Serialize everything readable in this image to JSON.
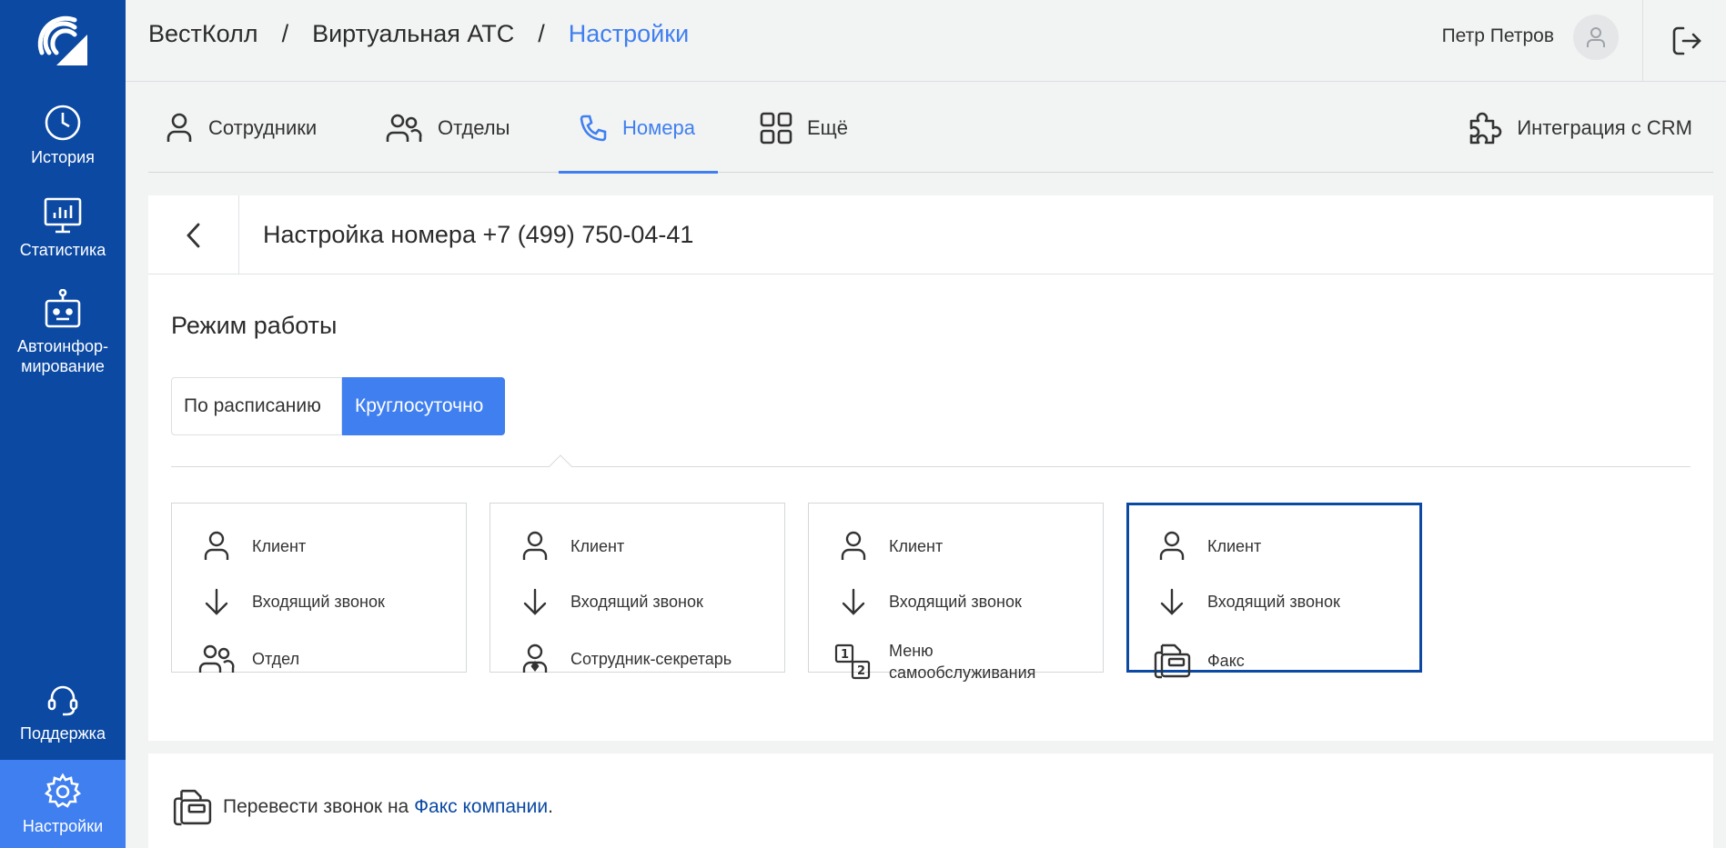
{
  "sidebar": {
    "items": [
      {
        "label": "История"
      },
      {
        "label": "Статистика"
      },
      {
        "label": "Автоинфор-\nмирование"
      },
      {
        "label": "Поддержка"
      },
      {
        "label": "Настройки"
      }
    ]
  },
  "header": {
    "breadcrumbs": [
      "ВестКолл",
      "Виртуальная АТС",
      "Настройки"
    ],
    "separator": "/",
    "user_name": "Петр Петров"
  },
  "tabs": [
    {
      "label": "Сотрудники"
    },
    {
      "label": "Отделы"
    },
    {
      "label": "Номера"
    },
    {
      "label": "Ещё"
    },
    {
      "label": "Интеграция с CRM"
    }
  ],
  "card": {
    "title": "Настройка номера +7 (499) 750-04-41",
    "section_title": "Режим работы",
    "mode_options": [
      "По расписанию",
      "Круглосуточно"
    ],
    "selected_mode": "Круглосуточно"
  },
  "routes": [
    {
      "client": "Клиент",
      "incoming": "Входящий звонок",
      "target": "Отдел"
    },
    {
      "client": "Клиент",
      "incoming": "Входящий звонок",
      "target": "Сотрудник-секретарь"
    },
    {
      "client": "Клиент",
      "incoming": "Входящий звонок",
      "target_line1": "Меню",
      "target_line2": "самообслуживания"
    },
    {
      "client": "Клиент",
      "incoming": "Входящий звонок",
      "target": "Факс"
    }
  ],
  "bottom": {
    "text": "Перевести звонок на ",
    "link": "Факс компании",
    "suffix": "."
  },
  "colors": {
    "sidebar": "#0b49a3",
    "accent": "#3f7ff0",
    "selected_border": "#0b49a3"
  }
}
